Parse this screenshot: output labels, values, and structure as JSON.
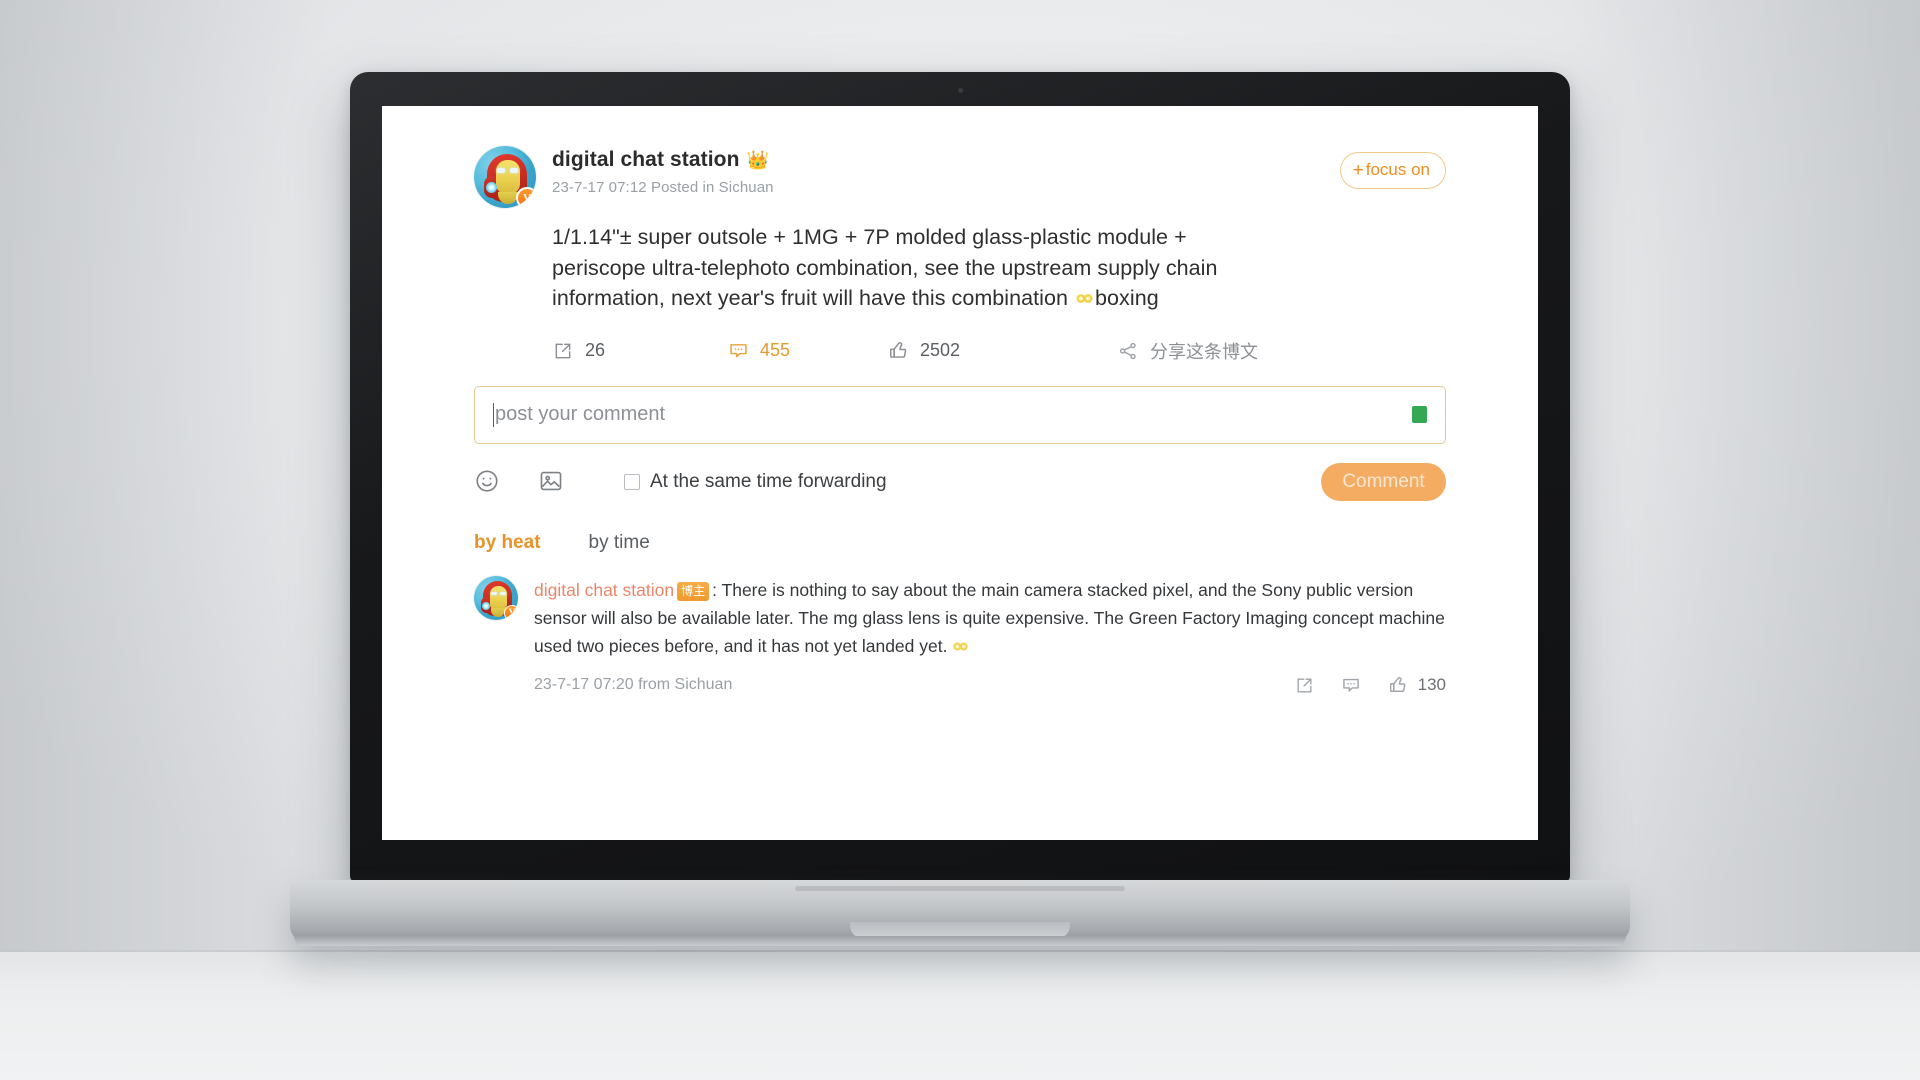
{
  "post": {
    "author_name": "digital chat station",
    "author_crown_icon": "crown-emoji",
    "verified_badge": "V",
    "meta": "23-7-17 07:12 Posted in Sichuan",
    "focus_button": "focus on",
    "focus_plus": "+",
    "body_text": "1/1.14\"± super outsole + 1MG + 7P molded glass-plastic module + periscope ultra-telephoto combination, see the upstream supply chain information, next year's fruit will have this combination ",
    "body_emoji_icon": "goggles-emoji",
    "body_text_tail": "boxing"
  },
  "stats": {
    "repost_icon": "share-arrow-icon",
    "repost_count": "26",
    "comment_icon": "comment-bubble-icon",
    "comment_count": "455",
    "like_icon": "thumbs-up-icon",
    "like_count": "2502",
    "share_icon": "share-nodes-icon",
    "share_label": "分享这条博文"
  },
  "composer": {
    "placeholder": "post your comment",
    "emoji_icon": "smiley-face-icon",
    "image_icon": "picture-icon",
    "green_badge_icon": "green-square-icon",
    "forward_checkbox_label": "At the same time forwarding",
    "forward_checked": false,
    "submit_label": "Comment"
  },
  "sort": {
    "tabs": [
      {
        "label": "by heat",
        "active": true
      },
      {
        "label": "by time",
        "active": false
      }
    ]
  },
  "comments": [
    {
      "user": "digital chat station",
      "badge": "博主",
      "separator": ":",
      "text": "There is nothing to say about the main camera stacked pixel, and the Sony public version sensor will also be available later. The mg glass lens is quite expensive. The Green Factory Imaging concept machine used two pieces before, and it has not yet landed yet.",
      "emoji_icon": "goggles-emoji",
      "time": "23-7-17 07:20 from Sichuan",
      "repost_icon": "share-arrow-icon",
      "reply_icon": "comment-bubble-icon",
      "like_icon": "thumbs-up-icon",
      "like_count": "130"
    }
  ],
  "colors": {
    "accent_orange": "#e8932a",
    "comment_orange": "#e89a2c",
    "user_link": "#ec8669",
    "button_bg": "#f4ac62",
    "input_border": "#e6c993",
    "green_badge": "#34a853"
  }
}
